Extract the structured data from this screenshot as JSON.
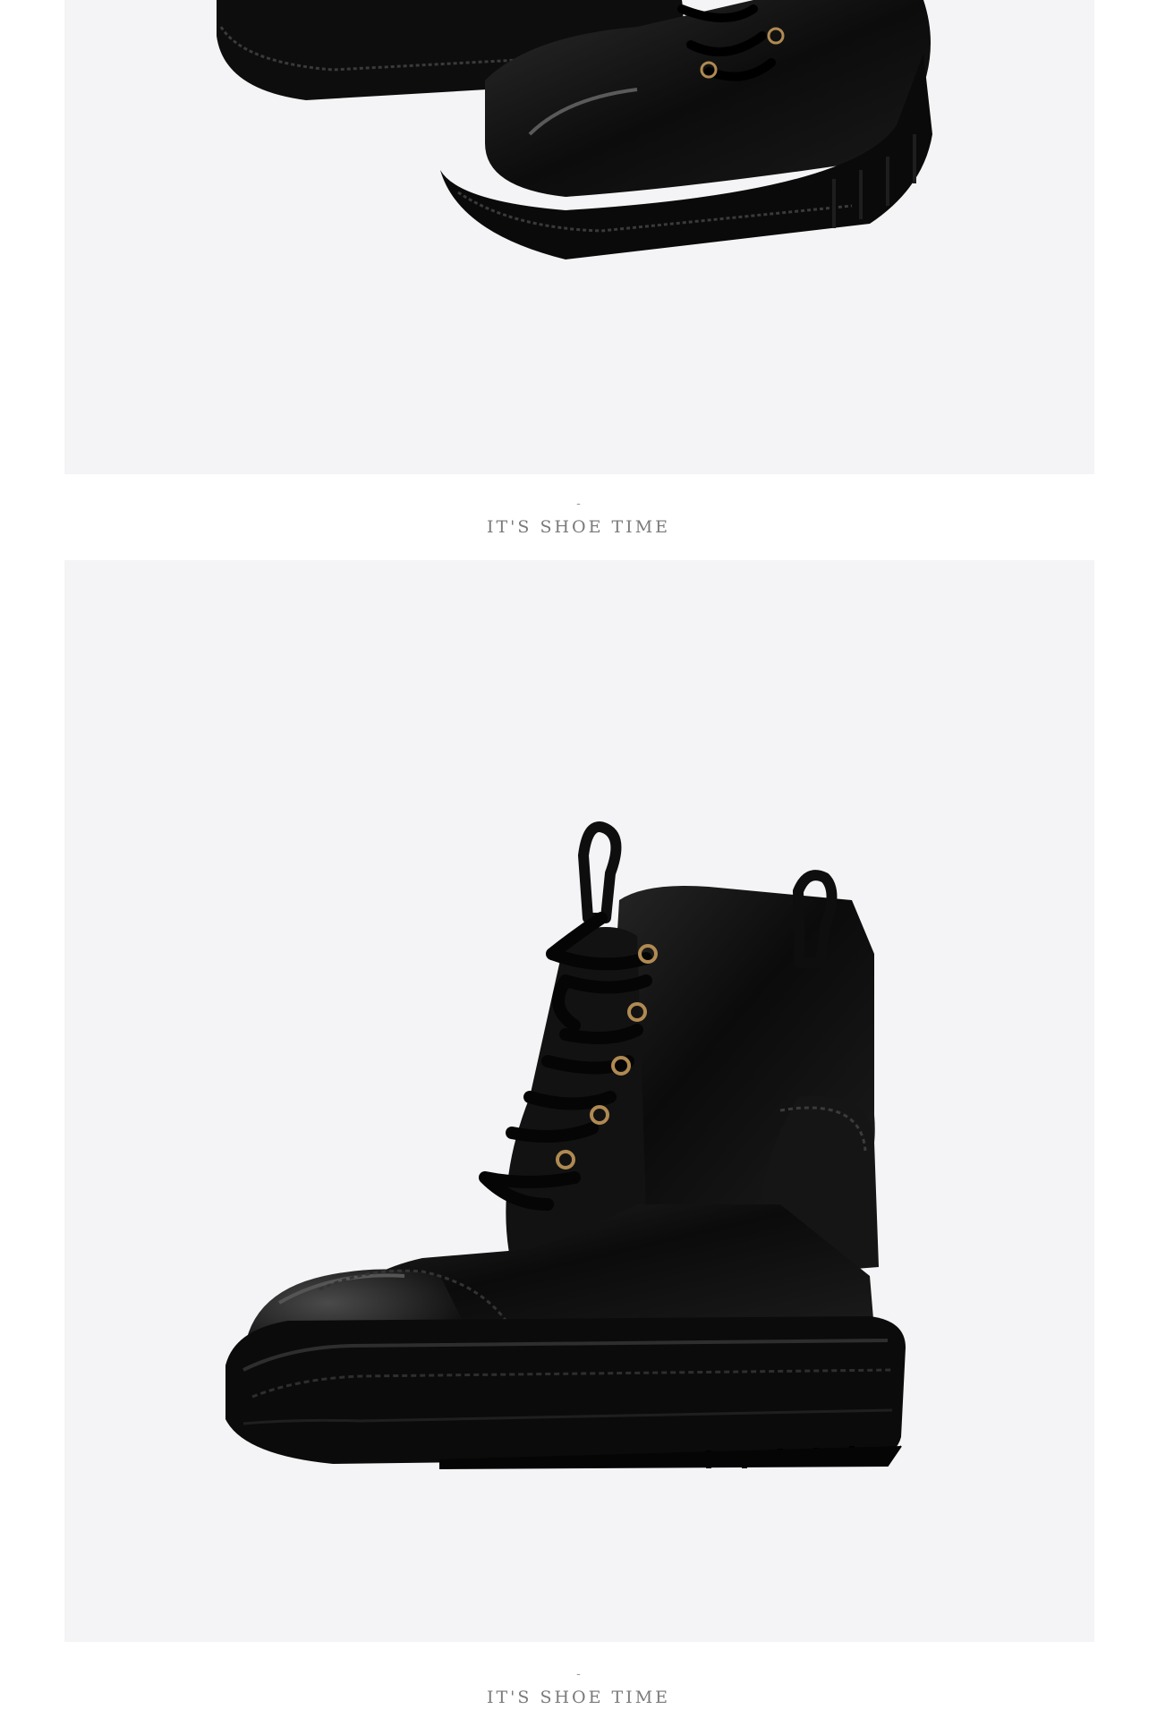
{
  "sections": [
    {
      "caption_dash": "-",
      "caption_text": "IT'S SHOE TIME"
    },
    {
      "caption_dash": "-",
      "caption_text": "IT'S SHOE TIME"
    }
  ],
  "colors": {
    "panel_background": "#f4f4f6",
    "boot_leather": "#111111",
    "eyelet": "#b08a52",
    "caption_text": "#7a7a7a"
  }
}
